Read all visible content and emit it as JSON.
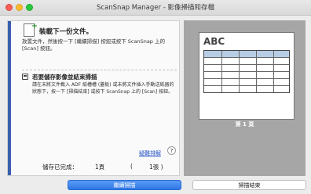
{
  "window": {
    "title": "ScanSnap Manager - 影像掃描和存檔"
  },
  "step1": {
    "title": "裝載下一份文件。",
    "desc": "放置文件，然後按一下 [繼續掃描] 按鈕或按下 ScanSnap 上的 [Scan] 按鈕。"
  },
  "step2": {
    "title": "若要儲存影像並結束掃描",
    "desc": "請在未將文件載入 ADF 紙槽槽 (蓋板) 或未將文件插入手動送紙器的狀態下，按一下 [掃描結束] 或按下 ScanSnap 上的 [Scan] 按鈕。"
  },
  "help": {
    "link": "疑難排解",
    "icon_glyph": "?"
  },
  "status": {
    "label": "儲存已完成：",
    "pages": "1頁",
    "paren_open": "(",
    "sheets": "1張 )"
  },
  "preview": {
    "doc_heading": "ABC",
    "page_label": "第 1 頁"
  },
  "buttons": {
    "continue": "繼續掃描",
    "finish": "掃描結束"
  },
  "colors": {
    "accent": "#3a5fb0",
    "primary_button": "#2f78e6",
    "preview_bg": "#a6a6a6",
    "link": "#2a56c6"
  }
}
